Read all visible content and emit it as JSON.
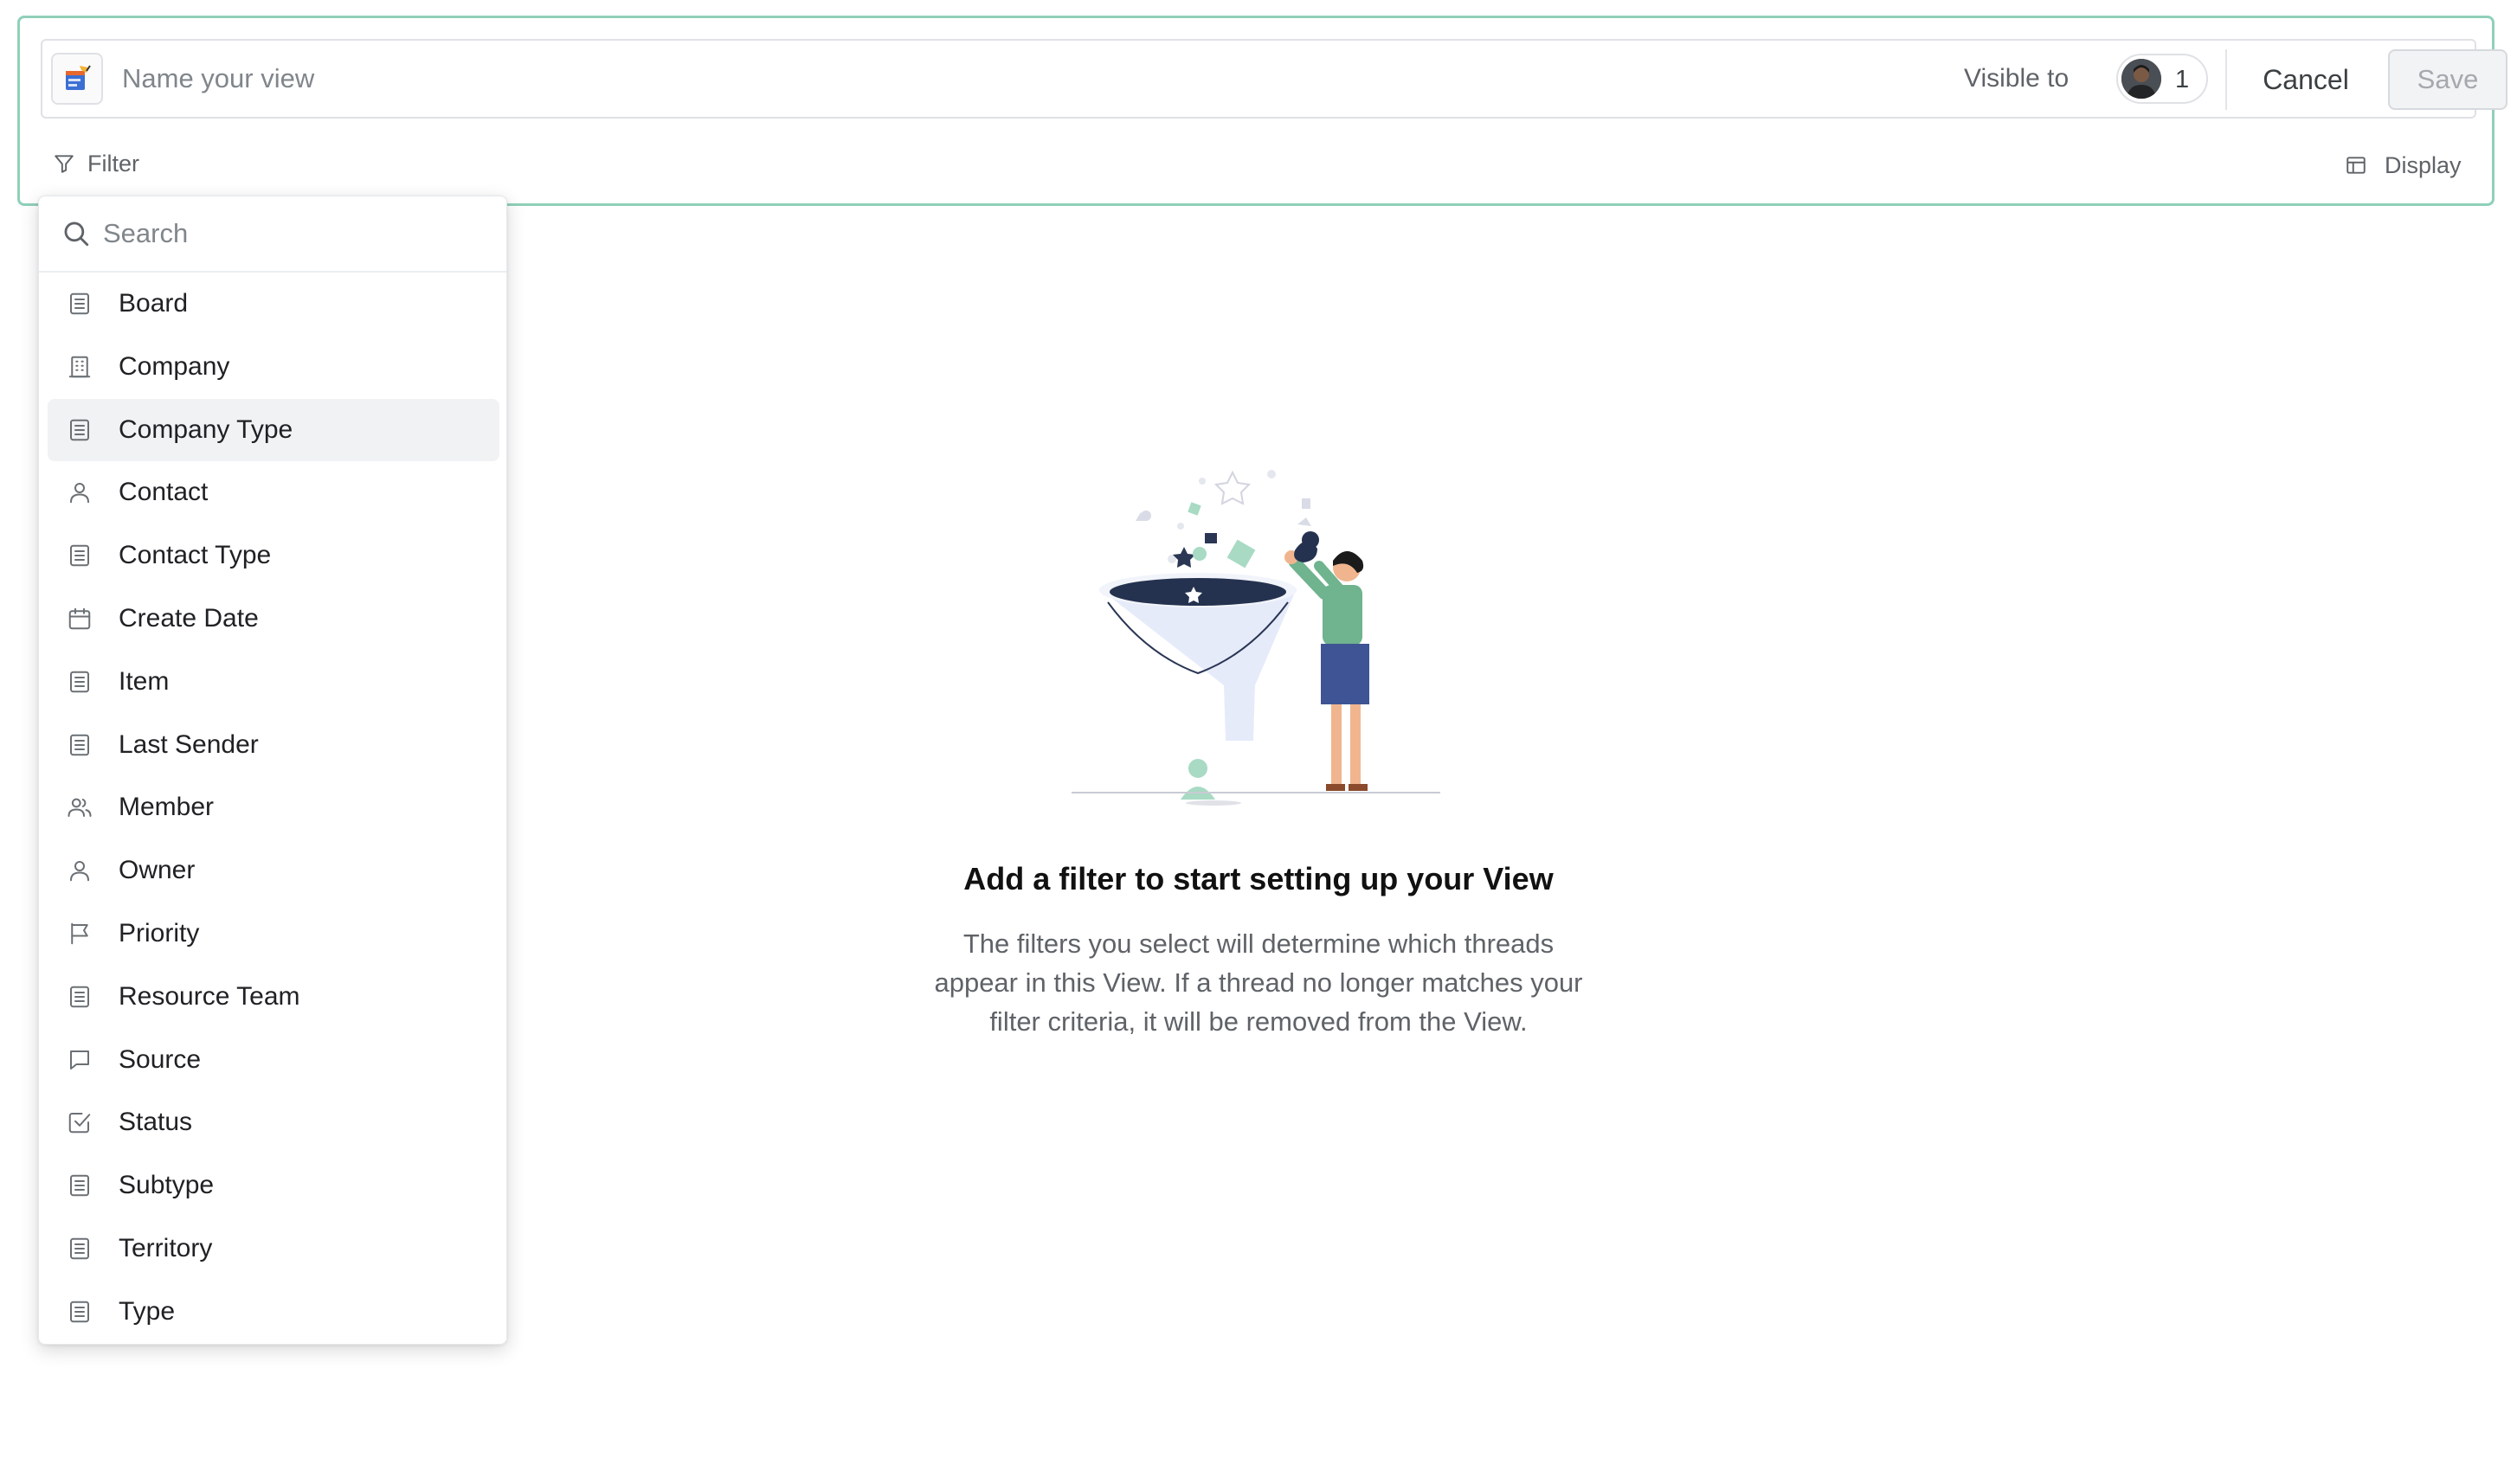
{
  "editor": {
    "name_placeholder": "Name your view",
    "name_value": "",
    "visible_to_label": "Visible to",
    "visible_count": "1",
    "cancel_label": "Cancel",
    "save_label": "Save",
    "filter_label": "Filter",
    "display_label": "Display",
    "accent_color": "#8fd0b8"
  },
  "filter_menu": {
    "search_placeholder": "Search",
    "hovered_item": "Company Type",
    "items": [
      {
        "label": "Board",
        "icon": "list-field-icon"
      },
      {
        "label": "Company",
        "icon": "building-icon"
      },
      {
        "label": "Company Type",
        "icon": "list-field-icon"
      },
      {
        "label": "Contact",
        "icon": "person-icon"
      },
      {
        "label": "Contact Type",
        "icon": "list-field-icon"
      },
      {
        "label": "Create Date",
        "icon": "calendar-icon"
      },
      {
        "label": "Item",
        "icon": "list-field-icon"
      },
      {
        "label": "Last Sender",
        "icon": "list-field-icon"
      },
      {
        "label": "Member",
        "icon": "people-icon"
      },
      {
        "label": "Owner",
        "icon": "person-icon"
      },
      {
        "label": "Priority",
        "icon": "flag-icon"
      },
      {
        "label": "Resource Team",
        "icon": "list-field-icon"
      },
      {
        "label": "Source",
        "icon": "chat-bubble-icon"
      },
      {
        "label": "Status",
        "icon": "checkbox-icon"
      },
      {
        "label": "Subtype",
        "icon": "list-field-icon"
      },
      {
        "label": "Territory",
        "icon": "list-field-icon"
      },
      {
        "label": "Type",
        "icon": "list-field-icon"
      }
    ]
  },
  "empty_state": {
    "title": "Add a filter to start setting up your View",
    "description": "The filters you select will determine which threads appear in this View. If a thread no longer matches your filter criteria, it will be removed from the View."
  }
}
